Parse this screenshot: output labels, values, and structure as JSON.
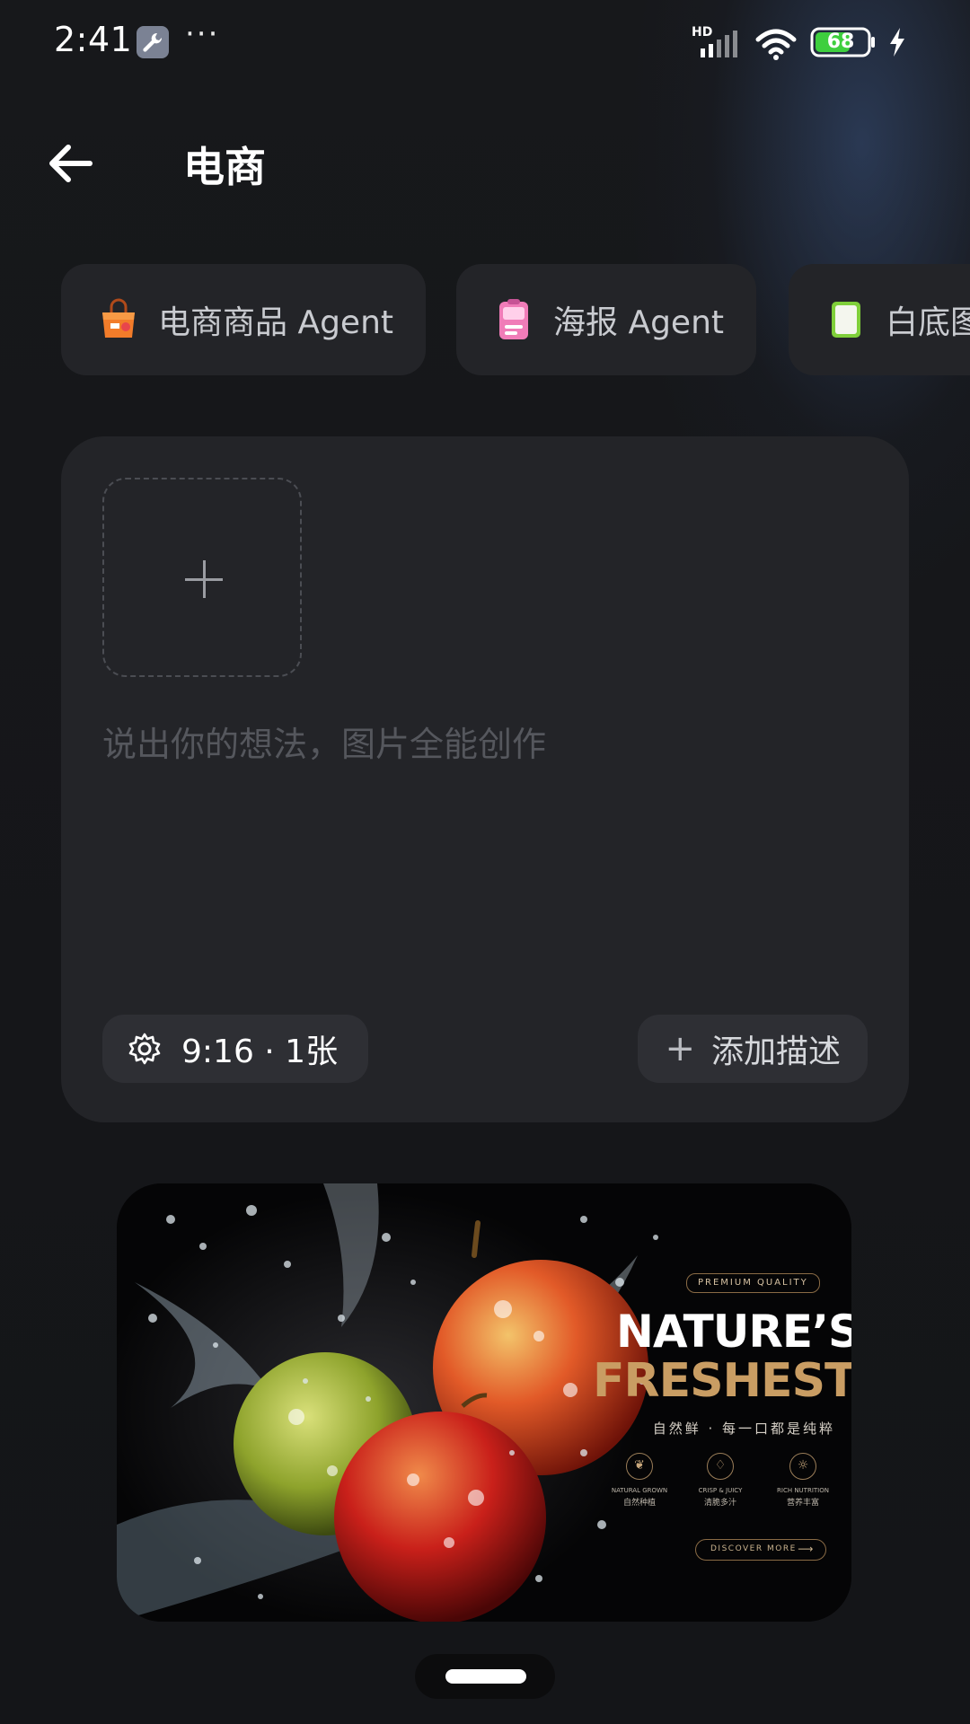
{
  "status_bar": {
    "time": "2:41",
    "network_label": "HD",
    "battery": "68",
    "more": "···"
  },
  "header": {
    "title": "电商"
  },
  "chips": [
    {
      "label": "电商商品 Agent",
      "icon": "shopping-bag-icon"
    },
    {
      "label": "海报 Agent",
      "icon": "poster-icon"
    },
    {
      "label": "白底图",
      "icon": "white-background-icon"
    }
  ],
  "composer": {
    "prompt_placeholder": "说出你的想法，图片全能创作",
    "settings_label": "9:16 · 1张",
    "add_description_label": "添加描述",
    "upload_icon": "plus-icon"
  },
  "preview": {
    "badge": "PREMIUM QUALITY",
    "headline_line1": "NATURE’S",
    "headline_line2": "FRESHEST",
    "subtitle_cn": "自然鲜 · 每一口都是纯粹",
    "features": [
      {
        "en": "NATURAL GROWN",
        "cn": "自然种植",
        "icon": "leaf-icon"
      },
      {
        "en": "CRISP & JUICY",
        "cn": "清脆多汁",
        "icon": "drop-icon"
      },
      {
        "en": "RICH NUTRITION",
        "cn": "营养丰富",
        "icon": "sun-icon"
      }
    ],
    "cta": "DISCOVER MORE"
  },
  "colors": {
    "background": "#151619",
    "card": "#232428",
    "pill": "#2e2f34",
    "accent_gold": "#c99d63"
  }
}
